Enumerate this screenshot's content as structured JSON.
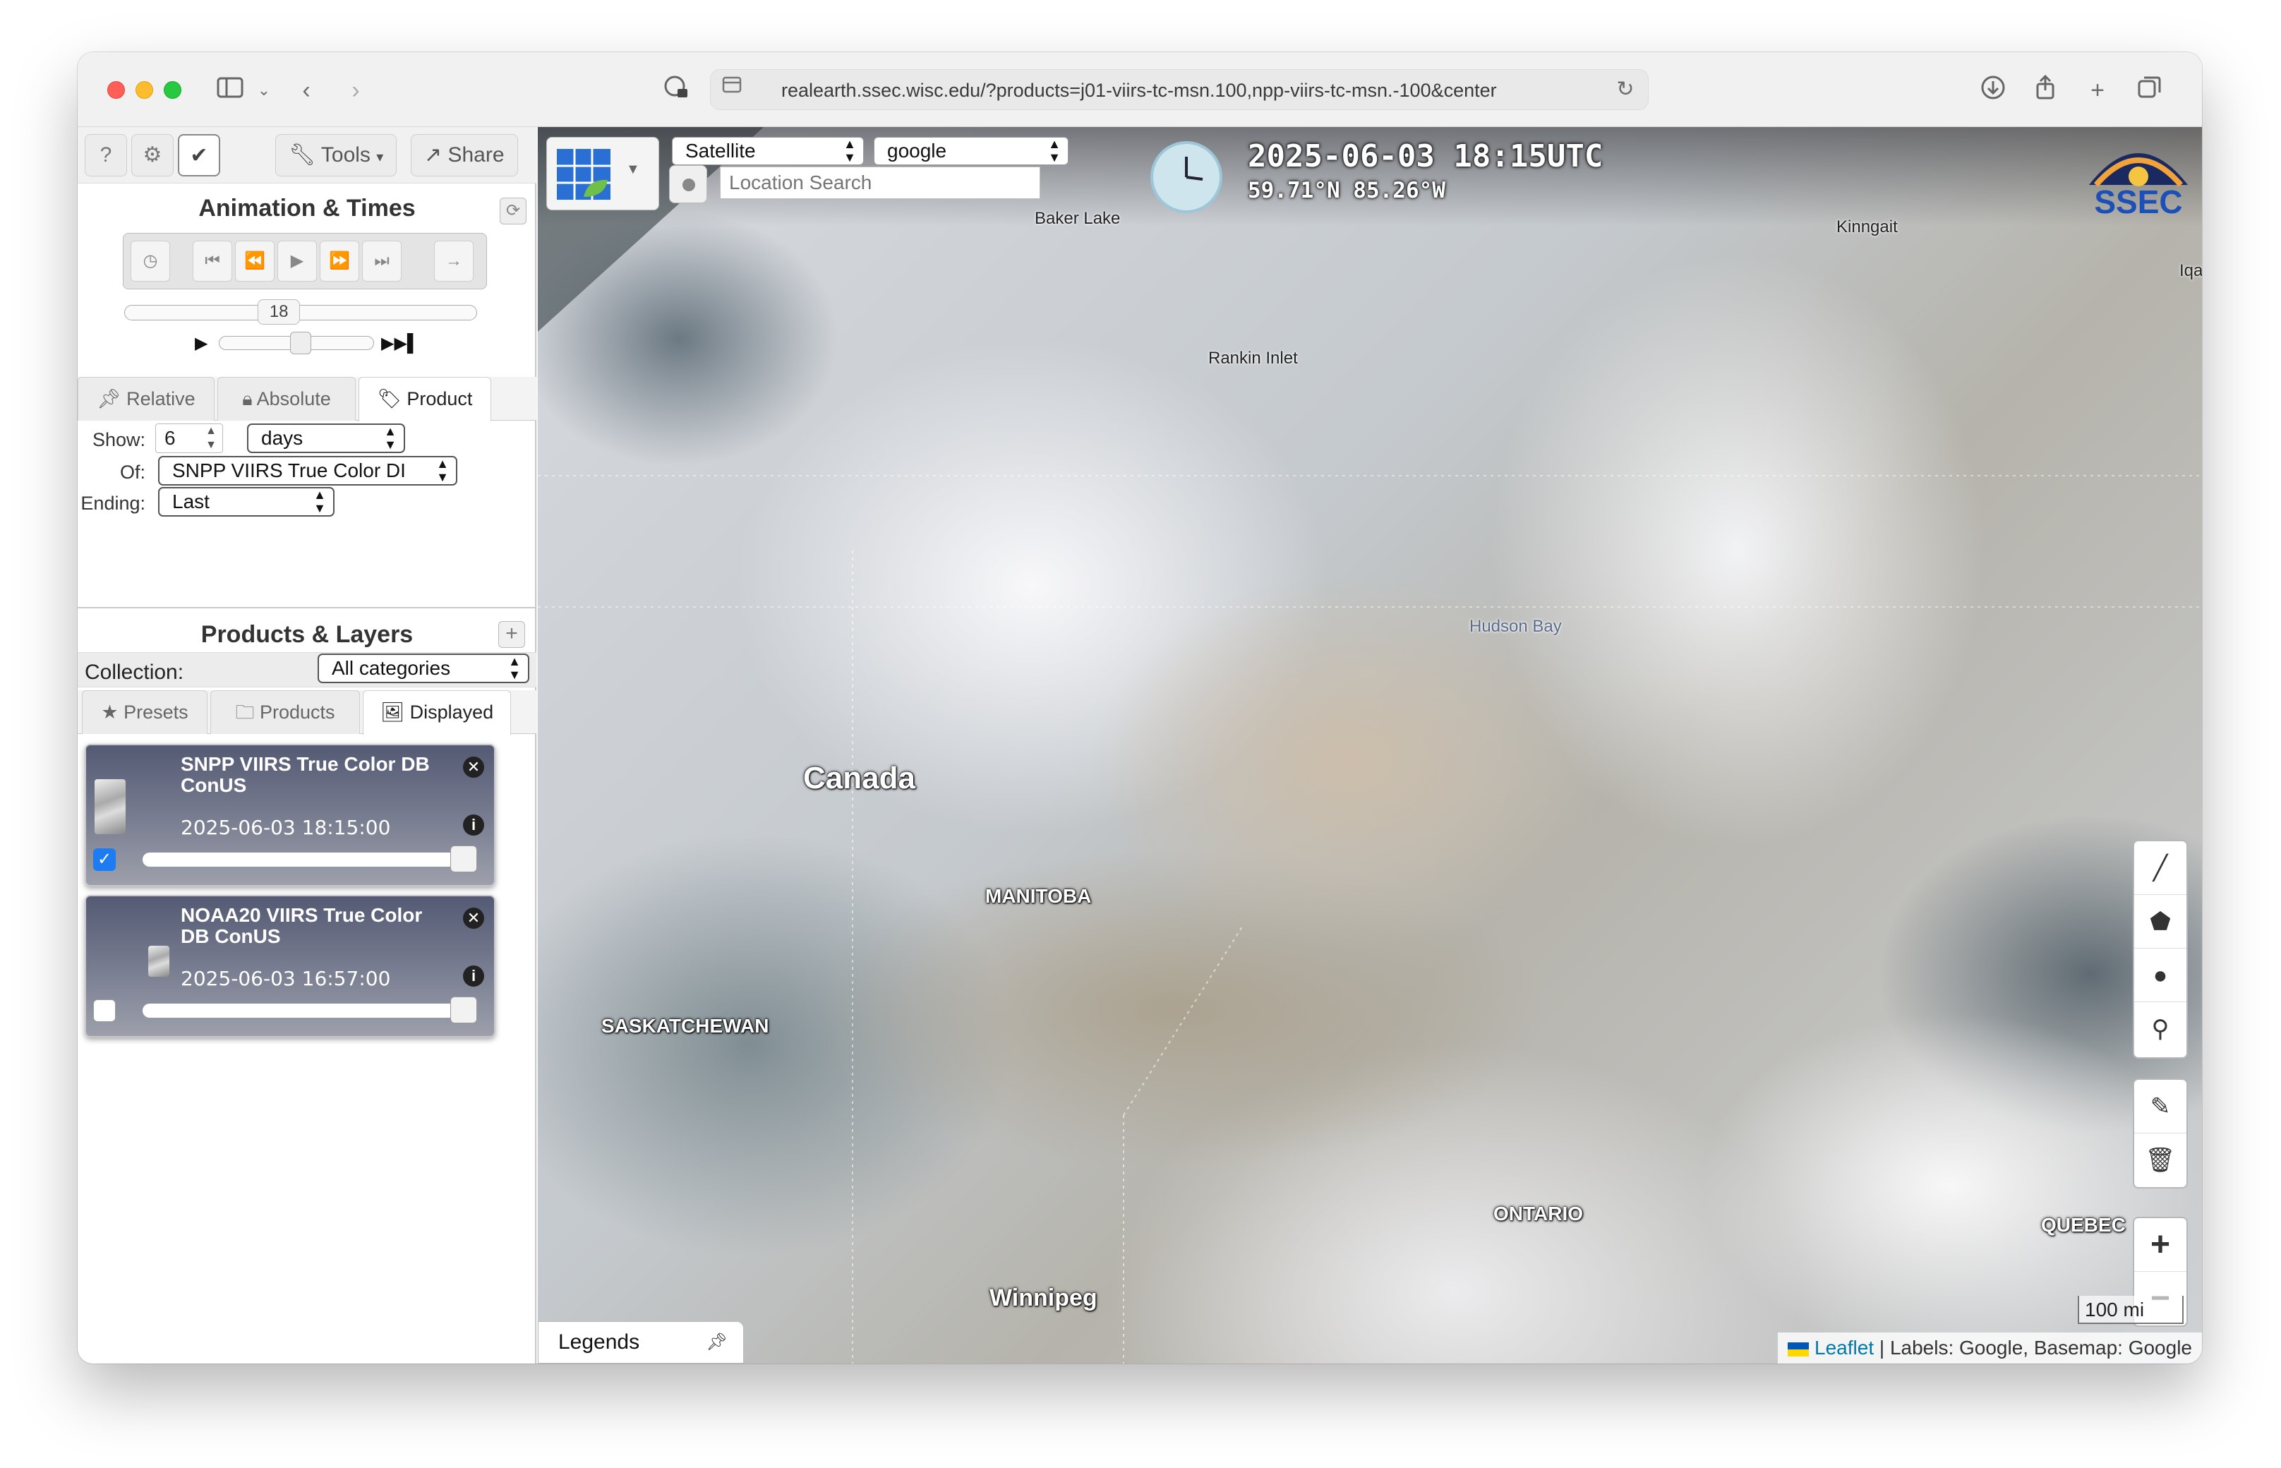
{
  "browser": {
    "url": "realearth.ssec.wisc.edu/?products=j01-viirs-tc-msn.100,npp-viirs-tc-msn.-100&center"
  },
  "toolbar": {
    "help_label": "?",
    "tools_label": "Tools",
    "share_label": "Share"
  },
  "animation": {
    "title": "Animation & Times",
    "frame_value": "18",
    "frame_position": 0.43,
    "speed_position": 0.53
  },
  "time_tabs": {
    "relative": "Relative",
    "absolute": "Absolute",
    "product": "Product"
  },
  "time_form": {
    "show_label": "Show:",
    "show_value": "6",
    "show_unit": "days",
    "of_label": "Of:",
    "of_value": "SNPP VIIRS True Color DI",
    "ending_label": "Ending:",
    "ending_value": "Last"
  },
  "products": {
    "title": "Products & Layers",
    "collection_label": "Collection:",
    "collection_value": "All categories",
    "tabs": {
      "presets": "Presets",
      "products": "Products",
      "displayed": "Displayed"
    },
    "layers": [
      {
        "title": "SNPP VIIRS True Color DB ConUS",
        "time": "2025-06-03 18:15:00",
        "checked": true,
        "opacity": 1.0
      },
      {
        "title": "NOAA20 VIIRS True Color DB ConUS",
        "time": "2025-06-03 16:57:00",
        "checked": false,
        "opacity": 1.0
      }
    ]
  },
  "map": {
    "basemap_select": "Satellite",
    "labels_select": "google",
    "location_placeholder": "Location Search",
    "datetime": "2025-06-03 18:15UTC",
    "coordinates": "59.71°N 85.26°W",
    "logo_text": "SSEC",
    "labels": {
      "baker_lake": "Baker Lake",
      "kinngait": "Kinngait",
      "iqaluit": "Iqal",
      "rankin_inlet": "Rankin Inlet",
      "hudson_bay": "Hudson Bay",
      "canada": "Canada",
      "manitoba": "MANITOBA",
      "saskatchewan": "SASKATCHEWAN",
      "ontario": "ONTARIO",
      "quebec": "QUEBEC",
      "winnipeg": "Winnipeg"
    },
    "scale_label": "100 mi",
    "legends_label": "Legends",
    "attribution_link": "Leaflet",
    "attribution_text": " | Labels: Google, Basemap: Google"
  },
  "colors": {
    "checkbox_on": "#1e7cf2",
    "attribution_link": "#0078a8"
  }
}
